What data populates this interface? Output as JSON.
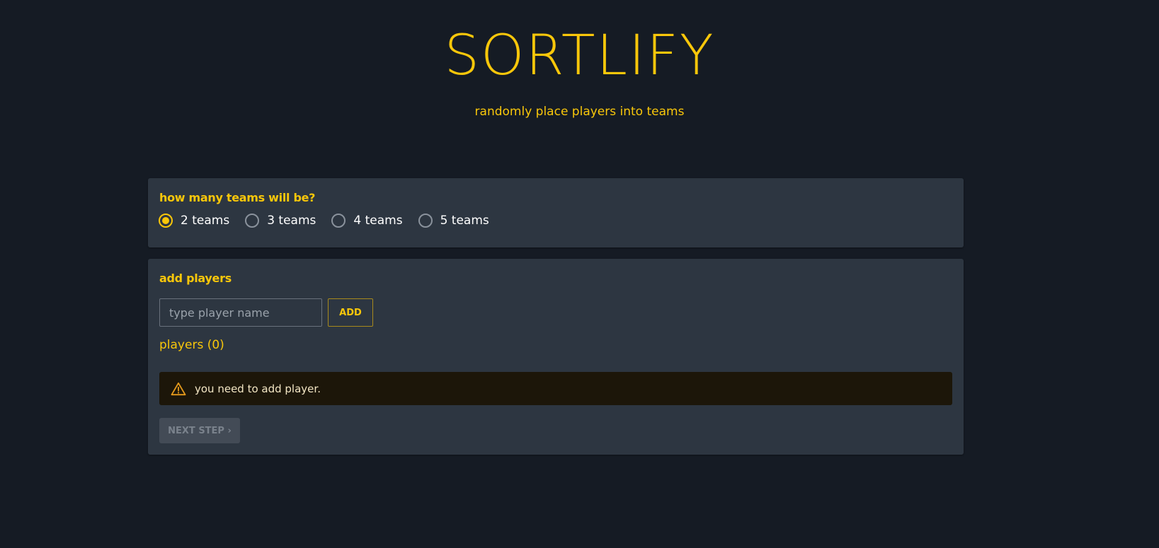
{
  "header": {
    "title": "SORTLIFY",
    "subtitle": "randomly place players into teams"
  },
  "teams_card": {
    "heading": "how many teams will be?",
    "options": [
      {
        "label": "2 teams",
        "checked": true
      },
      {
        "label": "3 teams",
        "checked": false
      },
      {
        "label": "4 teams",
        "checked": false
      },
      {
        "label": "5 teams",
        "checked": false
      }
    ]
  },
  "players_card": {
    "heading": "add players",
    "input_placeholder": "type player name",
    "input_value": "",
    "add_label": "ADD",
    "players_count_text": "players (0)",
    "alert_text": "you need to add player.",
    "alert_icon": "warning-icon",
    "next_label": "NEXT STEP ›"
  },
  "colors": {
    "background": "#151b24",
    "card": "#2d3641",
    "accent": "#f9c70a",
    "alert_bg": "#1c1609",
    "alert_icon": "#e59a1c",
    "disabled_button": "#434b56"
  }
}
